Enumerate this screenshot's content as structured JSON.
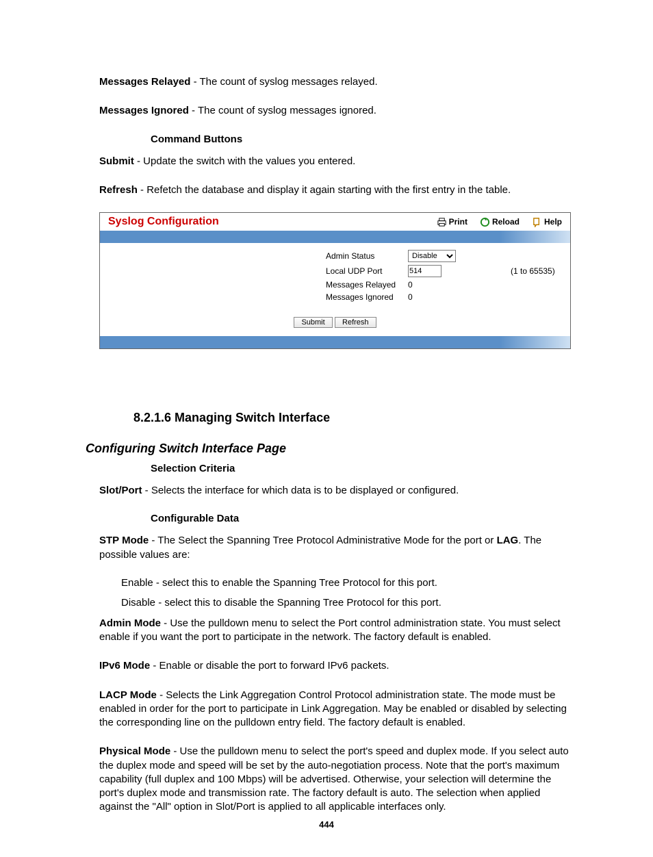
{
  "defs": {
    "messages_relayed": {
      "term": "Messages Relayed",
      "desc": " - The count of syslog messages relayed."
    },
    "messages_ignored": {
      "term": "Messages Ignored",
      "desc": " - The count of syslog messages ignored."
    },
    "command_buttons": "Command Buttons",
    "submit": {
      "term": "Submit",
      "desc": " - Update the switch with the values you entered."
    },
    "refresh": {
      "term": "Refresh",
      "desc": " - Refetch the database and display it again starting with the first entry in the table."
    }
  },
  "panel": {
    "title": "Syslog Configuration",
    "actions": {
      "print": "Print",
      "reload": "Reload",
      "help": "Help"
    },
    "fields": {
      "admin_status": {
        "label": "Admin Status",
        "value": "Disable"
      },
      "local_udp_port": {
        "label": "Local UDP Port",
        "value": "514",
        "hint": "(1 to 65535)"
      },
      "messages_relayed": {
        "label": "Messages Relayed",
        "value": "0"
      },
      "messages_ignored": {
        "label": "Messages Ignored",
        "value": "0"
      }
    },
    "buttons": {
      "submit": "Submit",
      "refresh": "Refresh"
    }
  },
  "sec": {
    "heading": "8.2.1.6 Managing Switch Interface",
    "subheading": "Configuring Switch Interface Page",
    "selection_criteria": "Selection Criteria",
    "slot_port": {
      "term": "Slot/Port",
      "desc": " - Selects the interface for which data is to be displayed or configured."
    },
    "configurable_data": "Configurable Data",
    "stp_mode": {
      "term": "STP Mode",
      "mid": " - The Select the Spanning Tree Protocol Administrative Mode for the port or ",
      "lag": "LAG",
      "tail": ". The possible values are:"
    },
    "stp_enable": "Enable - select this to enable the Spanning Tree Protocol for this port.",
    "stp_disable": "Disable - select this to disable the Spanning Tree Protocol for this port.",
    "admin_mode": {
      "term": "Admin Mode",
      "desc": " - Use the pulldown menu to select the Port control administration state. You must select enable if you want the port to participate in the network. The factory default is enabled."
    },
    "ipv6_mode": {
      "term": "IPv6 Mode",
      "desc": " - Enable or disable the port to forward IPv6 packets."
    },
    "lacp_mode": {
      "term": "LACP Mode",
      "desc": " - Selects the Link Aggregation Control Protocol administration state. The mode must be enabled in order for the port to participate in Link Aggregation. May be enabled or disabled by selecting the corresponding line on the pulldown entry field. The factory default is enabled."
    },
    "physical_mode": {
      "term": "Physical Mode",
      "desc": " - Use the pulldown menu to select the port's speed and duplex mode. If you select auto the duplex mode and speed will be set by the auto-negotiation process. Note that the port's maximum capability (full duplex and 100 Mbps) will be advertised. Otherwise, your selection will determine the port's duplex mode and transmission rate. The factory default is auto. The selection when applied against the \"All\" option in Slot/Port is applied to all applicable interfaces only."
    }
  },
  "page_number": "444"
}
